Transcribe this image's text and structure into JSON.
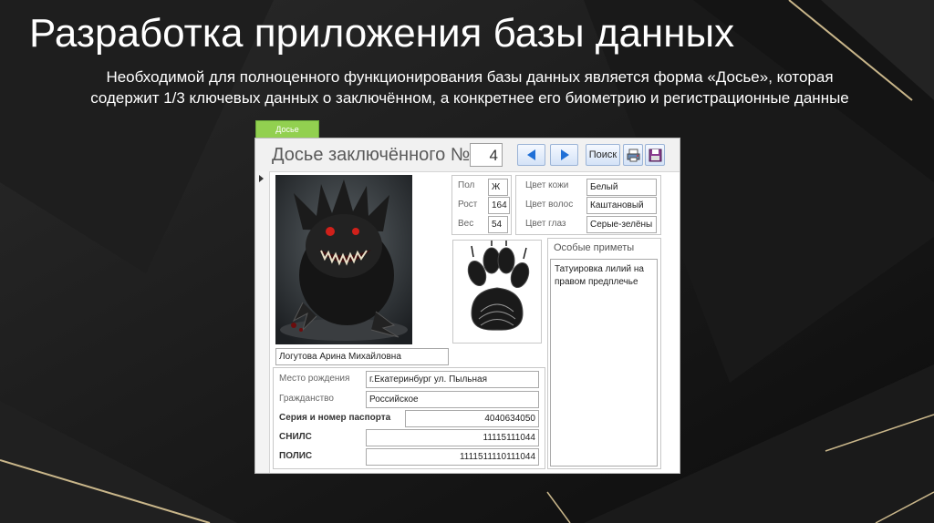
{
  "slide": {
    "title": "Разработка приложения базы данных",
    "subtitle_line1": "Необходимой для полноценного функционирования базы данных является форма «Досье», которая",
    "subtitle_line2": "содержит 1/3 ключевых данных о заключённом, а конкретнее его биометрию и регистрационные данные"
  },
  "form": {
    "tab_label": "Досье",
    "title": "Досье заключённого №",
    "record_number": "4",
    "search_label": "Поиск",
    "full_name": "Логутова Арина Михайловна",
    "biometrics": {
      "sex_label": "Пол",
      "sex_value": "Ж",
      "height_label": "Рост",
      "height_value": "164",
      "weight_label": "Вес",
      "weight_value": "54",
      "skin_label": "Цвет кожи",
      "skin_value": "Белый",
      "hair_label": "Цвет волос",
      "hair_value": "Каштановый",
      "eye_label": "Цвет глаз",
      "eye_value": "Серые-зелёны"
    },
    "special_marks": {
      "label": "Особые приметы",
      "value": "Татуировка лилий на правом предплечье"
    },
    "registration": {
      "birthplace_label": "Место рождения",
      "birthplace_value": "г.Екатеринбург ул. Пыльная",
      "citizenship_label": "Гражданство",
      "citizenship_value": "Российское",
      "passport_label": "Серия и номер паспорта",
      "passport_value": "4040634050",
      "snils_label": "СНИЛС",
      "snils_value": "11115111044",
      "polis_label": "ПОЛИС",
      "polis_value": "1111511110111044"
    },
    "icons": [
      "left-arrow-icon",
      "right-arrow-icon",
      "print-icon",
      "save-icon"
    ],
    "accent": "#92d050",
    "nav_arrow_color": "#1f6fd6"
  }
}
